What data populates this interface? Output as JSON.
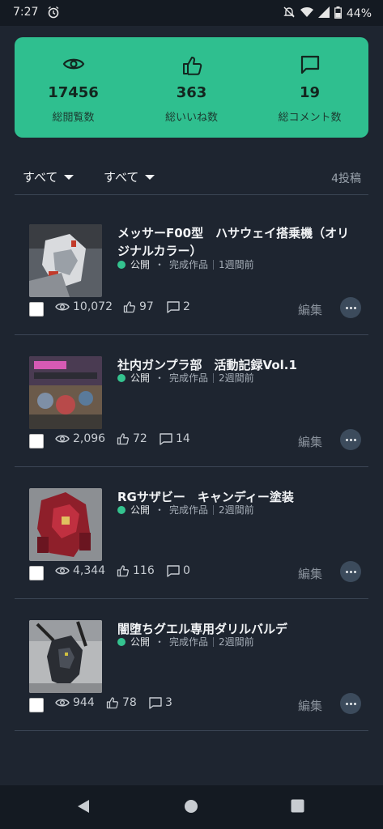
{
  "status_bar": {
    "time": "7:27",
    "battery": "44%"
  },
  "stats": [
    {
      "icon": "eye-icon",
      "value": "17456",
      "label": "総閲覧数"
    },
    {
      "icon": "thumbs-up-icon",
      "value": "363",
      "label": "総いいね数"
    },
    {
      "icon": "comment-icon",
      "value": "19",
      "label": "総コメント数"
    }
  ],
  "filters": {
    "filter1": "すべて",
    "filter2": "すべて",
    "post_count": "4投稿"
  },
  "posts": [
    {
      "title": "メッサーF00型　ハサウェイ搭乗機（オリジナルカラー）",
      "status": "公開",
      "category": "完成作品",
      "time": "1週間前",
      "views": "10,072",
      "likes": "97",
      "comments": "2",
      "edit": "編集"
    },
    {
      "title": "社内ガンプラ部　活動記録Vol.1",
      "status": "公開",
      "category": "完成作品",
      "time": "2週間前",
      "views": "2,096",
      "likes": "72",
      "comments": "14",
      "edit": "編集"
    },
    {
      "title": "RGサザビー　キャンディー塗装",
      "status": "公開",
      "category": "完成作品",
      "time": "2週間前",
      "views": "4,344",
      "likes": "116",
      "comments": "0",
      "edit": "編集"
    },
    {
      "title": "闇堕ちグエル専用ダリルバルデ",
      "status": "公開",
      "category": "完成作品",
      "time": "2週間前",
      "views": "944",
      "likes": "78",
      "comments": "3",
      "edit": "編集"
    }
  ],
  "meta_separator": "・"
}
